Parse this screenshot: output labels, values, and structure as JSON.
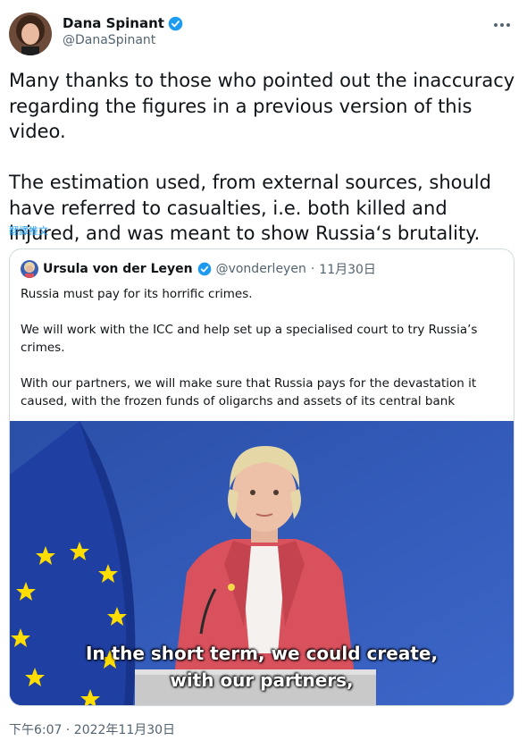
{
  "author": {
    "display_name": "Dana Spinant",
    "handle": "@DanaSpinant"
  },
  "tweet": {
    "text": "Many thanks to those who pointed out the inaccuracy regarding the figures in a previous version of this video.\n\nThe estimation used, from external sources, should have referred to casualties, i.e. both killed and injured, and was meant to show Russia‘s brutality.",
    "translate_label": "翻譯推文",
    "timestamp": "下午6:07 · 2022年11月30日"
  },
  "quoted": {
    "display_name": "Ursula von der Leyen",
    "handle": "@vonderleyen",
    "date": "11月30日",
    "text": "Russia must pay for its horrific crimes.\n\nWe will work with the ICC and help set up a specialised court to try Russia’s crimes.\n\nWith our partners, we will make sure that Russia pays for the devastation it caused, with the frozen funds of oligarchs and assets of its central bank",
    "video_caption_line1": "In the short term, we could create,",
    "video_caption_line2": "with our partners,"
  },
  "icons": {
    "verified": "verified-badge-icon",
    "more": "more-options-icon"
  },
  "colors": {
    "accent": "#1d9bf0",
    "secondary_text": "#536471",
    "border": "#cfd9de",
    "video_background": "#2d55b8",
    "eu_flag": "#1f3fa3",
    "eu_star": "#ffdd00",
    "jacket": "#d9515d"
  }
}
